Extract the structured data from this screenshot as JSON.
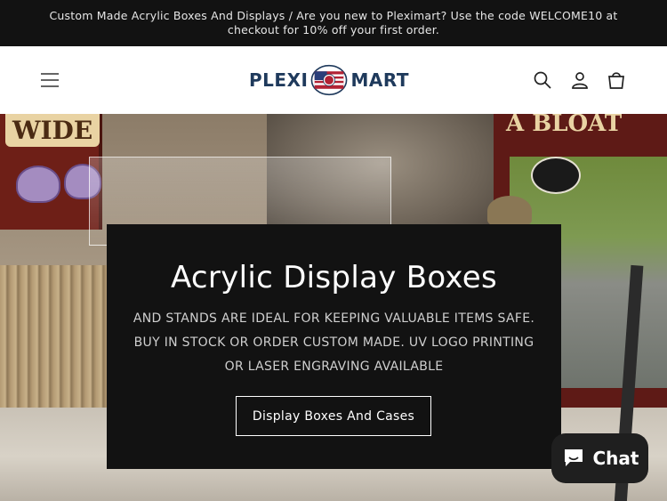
{
  "announcement": {
    "text": "Custom Made Acrylic Boxes And Displays / Are you new to Pleximart? Use the code WELCOME10 at checkout for 10% off your first order."
  },
  "header": {
    "logo_left": "PLEXI",
    "logo_right": "MART",
    "logo_badge_top": "MADE IN",
    "logo_badge_bottom": "USA",
    "icons": [
      "hamburger-menu-icon",
      "search-icon",
      "account-icon",
      "cart-icon"
    ]
  },
  "hero": {
    "title": "Acrylic Display Boxes",
    "subtitle": "AND STANDS ARE IDEAL FOR KEEPING VALUABLE ITEMS SAFE. BUY IN STOCK OR ORDER CUSTOM MADE. UV LOGO PRINTING OR LASER ENGRAVING AVAILABLE",
    "button_label": "Display Boxes And Cases",
    "background_signs": {
      "left_sign_text": "WIDE",
      "right_sign_text": "A BLOAT"
    }
  },
  "chat": {
    "label": "Chat",
    "icon": "chat-bubble-icon"
  },
  "colors": {
    "announcement_bg": "#121212",
    "card_bg": "#121212",
    "logo_navy": "#1f3a5c",
    "chat_bg": "#1f1f1f"
  }
}
